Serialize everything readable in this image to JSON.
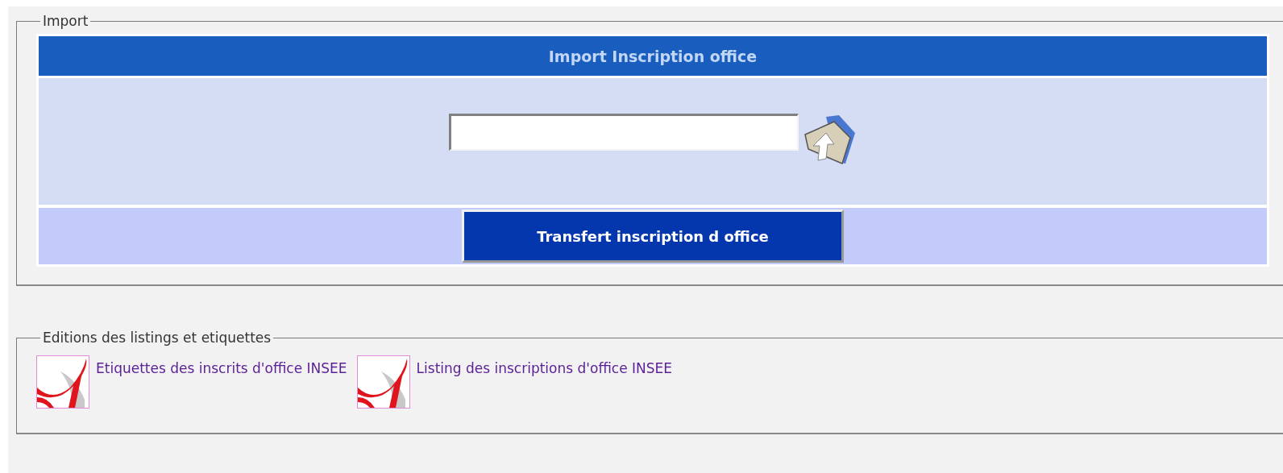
{
  "import_section": {
    "legend": "Import",
    "title": "Import Inscription office",
    "transfer_button": "Transfert inscription d office"
  },
  "editions_section": {
    "legend": "Editions des listings et etiquettes",
    "links": [
      {
        "label": "Etiquettes des inscrits d'office INSEE"
      },
      {
        "label": "Listing des inscriptions d'office INSEE"
      }
    ]
  }
}
